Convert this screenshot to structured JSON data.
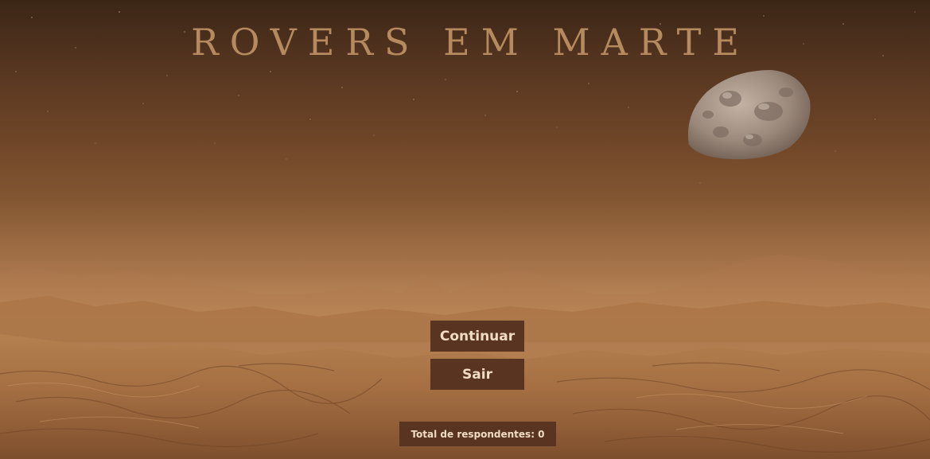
{
  "game": {
    "title": "ROVERS EM MARTE"
  },
  "menu": {
    "continue_label": "Continuar",
    "exit_label": "Sair"
  },
  "stats": {
    "label": "Total de respondentes:",
    "total_respondents": 0,
    "display": "Total de respondentes: 0"
  },
  "colors": {
    "button_bg": "#583421",
    "button_text": "#f0dcc4",
    "title_text": "#b58a5e",
    "sky_top": "#3b2616",
    "sky_horizon": "#b07c50",
    "ground": "#b48050"
  }
}
